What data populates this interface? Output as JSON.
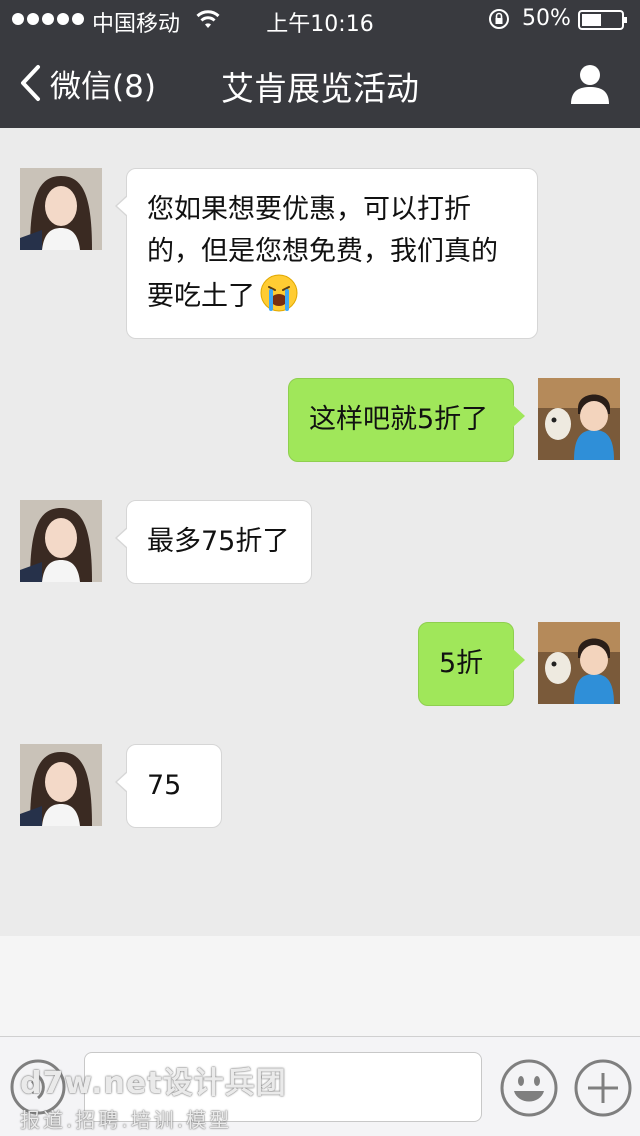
{
  "status": {
    "carrier": "中国移动",
    "time": "上午10:16",
    "battery": "50%"
  },
  "nav": {
    "back_label": "微信(8)",
    "title": "艾肯展览活动"
  },
  "messages": [
    {
      "side": "left",
      "text": "您如果想要优惠，可以打折的，但是您想免费，我们真的要吃土了",
      "emoji": "crying-face"
    },
    {
      "side": "right",
      "text": "这样吧就5折了"
    },
    {
      "side": "left",
      "text": "最多75折了"
    },
    {
      "side": "right",
      "text": "5折"
    },
    {
      "side": "left",
      "text": "75"
    }
  ],
  "watermark": {
    "line1": "d7w.net设计兵团",
    "line2": "报道.招聘.培训.模型"
  },
  "colors": {
    "nav_bg": "#393a3f",
    "chat_bg": "#ebebeb",
    "sent_bubble": "#a0e75a",
    "received_bubble": "#ffffff"
  }
}
